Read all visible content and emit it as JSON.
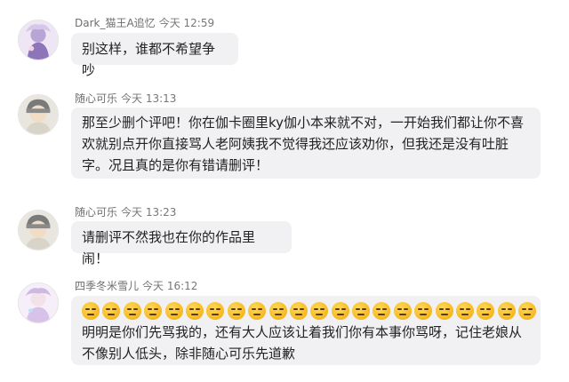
{
  "comments": [
    {
      "sender": "Dark_猫王A追忆",
      "time": "今天 12:59",
      "lines": [
        "别这样，谁都不希望争吵"
      ]
    },
    {
      "sender": "随心可乐",
      "time": "今天 13:13",
      "lines": [
        "那至少删个评吧！你在伽卡圈里ky伽小本来就不对，一开始我们都让你不喜",
        "欢就别点开你直接骂人老阿姨我不觉得我还应该劝你，但我还是没有吐脏",
        "字。况且真的是你有错请删评！"
      ]
    },
    {
      "sender": "随心可乐",
      "time": "今天 13:23",
      "lines": [
        "请删评不然我也在你的作品里闹！"
      ]
    },
    {
      "sender": "四季冬米雪儿",
      "time": "今天 16:12",
      "emoji_name": "unamused-face-emoji",
      "emoji_count": 22,
      "lines": [
        "明明是你们先骂我的，还有大人应该让着我们你有本事你骂呀，记住老娘从",
        "不像别人低头，除非随心可乐先道歉"
      ]
    }
  ]
}
